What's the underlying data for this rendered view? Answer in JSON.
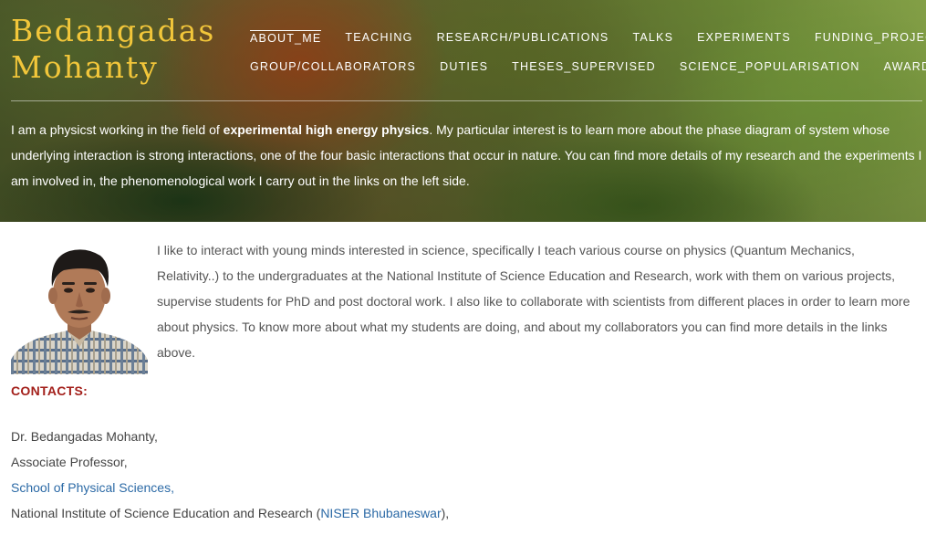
{
  "site": {
    "name_line1": "Bedangadas",
    "name_line2": "Mohanty"
  },
  "nav": {
    "items": [
      {
        "label": "ABOUT_ME"
      },
      {
        "label": "TEACHING"
      },
      {
        "label": "RESEARCH/PUBLICATIONS"
      },
      {
        "label": "TALKS"
      },
      {
        "label": "EXPERIMENTS"
      },
      {
        "label": "FUNDING_PROJECTS"
      },
      {
        "label": "GROUP/COLLABORATORS"
      },
      {
        "label": "DUTIES"
      },
      {
        "label": "THESES_SUPERVISED"
      },
      {
        "label": "SCIENCE_POPULARISATION"
      },
      {
        "label": "AWARDS"
      }
    ],
    "active": "ABOUT_ME"
  },
  "intro": {
    "before": "I am a physicst working in the field of ",
    "emphasis": "experimental high energy physics",
    "after": ". My particular interest is to learn more about the phase diagram of system whose underlying interaction is strong interactions, one of the four basic interactions that occur in nature. You can find more details of my research and the experiments I am involved in, the phenomenological work I carry out in the links on the left side."
  },
  "bio": "I like to interact with young minds interested in science, specifically I teach various course on physics (Quantum Mechanics, Relativity..) to the undergraduates at the National Institute of Science Education and Research, work with them on various projects, supervise students for PhD and post doctoral work. I also like to collaborate with scientists from different places in order to learn more about physics. To know more about what my students are doing, and about my collaborators you can find more details in the links above.",
  "contacts": {
    "heading": "CONTACTS:",
    "name": "Dr. Bedangadas Mohanty,",
    "title": "Associate Professor,",
    "school_link": "School of Physical Sciences,",
    "institute_before": "National Institute of Science Education and Research (",
    "institute_link": "NISER Bhubaneswar",
    "institute_after": "),"
  },
  "colors": {
    "title_gold": "#f2c63a",
    "contacts_red": "#a3201b",
    "link_blue": "#2c6aa6"
  }
}
